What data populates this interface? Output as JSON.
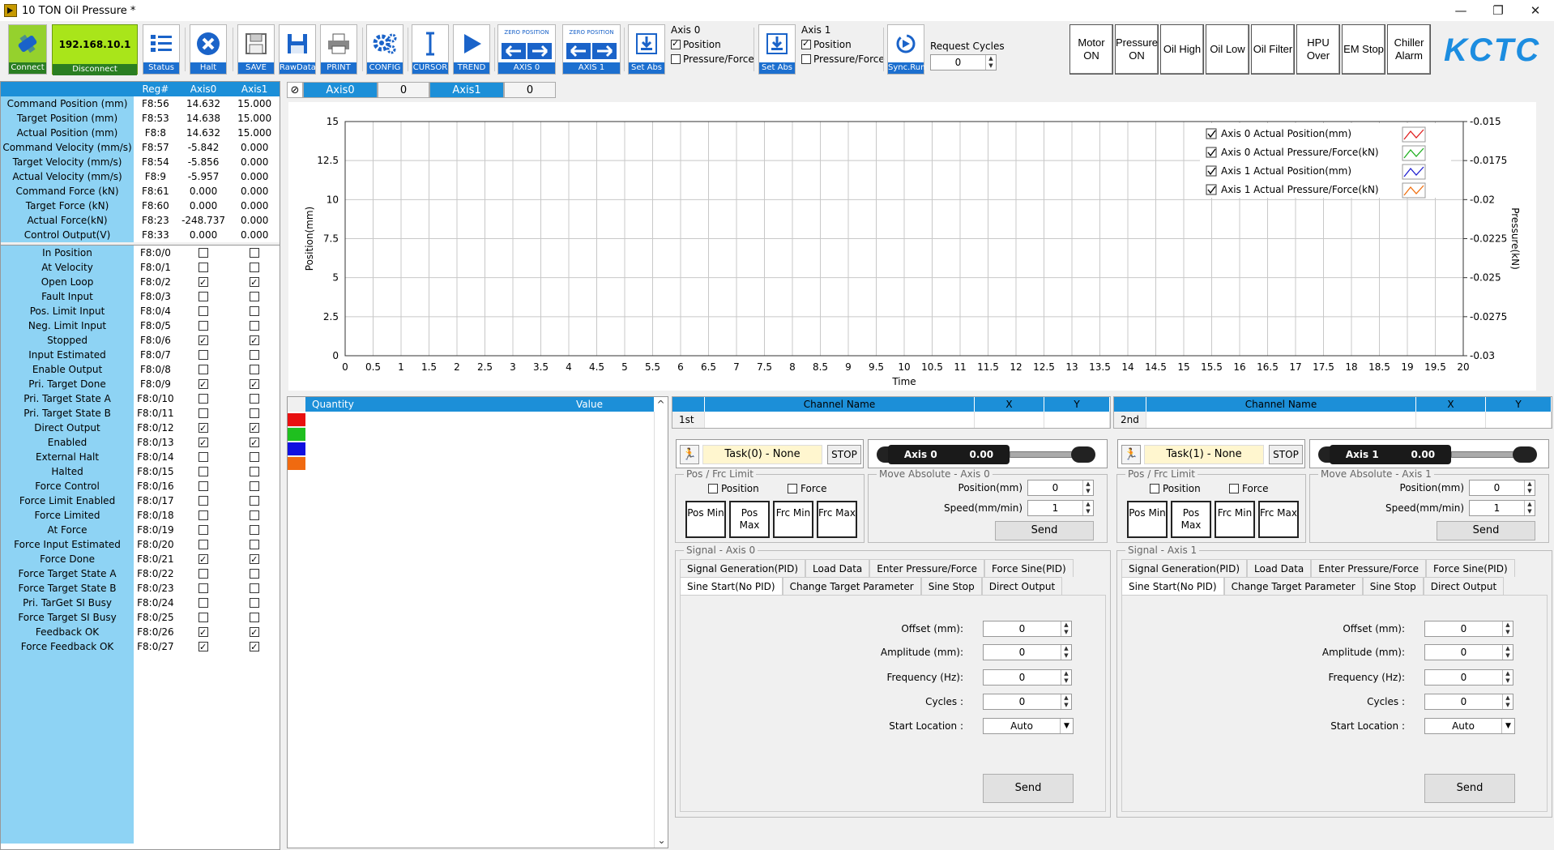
{
  "window": {
    "title": "10 TON Oil Pressure *",
    "minimize": "—",
    "restore": "❐",
    "close": "✕"
  },
  "toolbar": {
    "connect": "Connect",
    "ip": "192.168.10.1",
    "disconnect": "Disconnect",
    "status": "Status",
    "halt": "Halt",
    "save": "SAVE",
    "rawdata": "RawData",
    "print": "PRINT",
    "config": "CONFIG",
    "cursor": "CURSOR",
    "trend": "TREND",
    "zero_position": "ZERO POSITION",
    "axis0_btn": "AXIS 0",
    "axis1_btn": "AXIS 1",
    "set_abs": "Set Abs",
    "sync_run": "Sync.Run",
    "axis0": {
      "title": "Axis 0",
      "position": "Position",
      "pressure_force": "Pressure/Force",
      "position_checked": true,
      "pf_checked": false
    },
    "axis1": {
      "title": "Axis 1",
      "position": "Position",
      "pressure_force": "Pressure/Force",
      "position_checked": true,
      "pf_checked": false
    },
    "request_cycles_label": "Request Cycles",
    "request_cycles_value": "0"
  },
  "status_buttons": [
    "Motor ON",
    "Pressure ON",
    "Oil High",
    "Oil Low",
    "Oil Filter",
    "HPU Over",
    "EM Stop",
    "Chiller Alarm"
  ],
  "logo": "KCTC",
  "grid": {
    "headers": {
      "reg": "Reg#",
      "axis0": "Axis0",
      "axis1": "Axis1"
    },
    "values": [
      {
        "name": "Command Position (mm)",
        "reg": "F8:56",
        "a0": "14.632",
        "a1": "15.000"
      },
      {
        "name": "Target Position (mm)",
        "reg": "F8:53",
        "a0": "14.638",
        "a1": "15.000"
      },
      {
        "name": "Actual Position (mm)",
        "reg": "F8:8",
        "a0": "14.632",
        "a1": "15.000"
      },
      {
        "name": "Command Velocity (mm/s)",
        "reg": "F8:57",
        "a0": "-5.842",
        "a1": "0.000"
      },
      {
        "name": "Target Velocity (mm/s)",
        "reg": "F8:54",
        "a0": "-5.856",
        "a1": "0.000"
      },
      {
        "name": "Actual Velocity (mm/s)",
        "reg": "F8:9",
        "a0": "-5.957",
        "a1": "0.000"
      },
      {
        "name": "Command Force (kN)",
        "reg": "F8:61",
        "a0": "0.000",
        "a1": "0.000"
      },
      {
        "name": "Target Force (kN)",
        "reg": "F8:60",
        "a0": "0.000",
        "a1": "0.000"
      },
      {
        "name": "Actual Force(kN)",
        "reg": "F8:23",
        "a0": "-248.737",
        "a1": "0.000"
      },
      {
        "name": "Control Output(V)",
        "reg": "F8:33",
        "a0": "0.000",
        "a1": "0.000"
      }
    ],
    "flags": [
      {
        "name": "In Position",
        "reg": "F8:0/0",
        "a0": false,
        "a1": false
      },
      {
        "name": "At Velocity",
        "reg": "F8:0/1",
        "a0": false,
        "a1": false
      },
      {
        "name": "Open Loop",
        "reg": "F8:0/2",
        "a0": true,
        "a1": true
      },
      {
        "name": "Fault Input",
        "reg": "F8:0/3",
        "a0": false,
        "a1": false
      },
      {
        "name": "Pos. Limit Input",
        "reg": "F8:0/4",
        "a0": false,
        "a1": false
      },
      {
        "name": "Neg. Limit Input",
        "reg": "F8:0/5",
        "a0": false,
        "a1": false
      },
      {
        "name": "Stopped",
        "reg": "F8:0/6",
        "a0": true,
        "a1": true
      },
      {
        "name": "Input Estimated",
        "reg": "F8:0/7",
        "a0": false,
        "a1": false
      },
      {
        "name": "Enable Output",
        "reg": "F8:0/8",
        "a0": false,
        "a1": false
      },
      {
        "name": "Pri. Target Done",
        "reg": "F8:0/9",
        "a0": true,
        "a1": true
      },
      {
        "name": "Pri. Target State A",
        "reg": "F8:0/10",
        "a0": false,
        "a1": false
      },
      {
        "name": "Pri. Target State B",
        "reg": "F8:0/11",
        "a0": false,
        "a1": false
      },
      {
        "name": "Direct Output",
        "reg": "F8:0/12",
        "a0": true,
        "a1": true
      },
      {
        "name": "Enabled",
        "reg": "F8:0/13",
        "a0": true,
        "a1": true
      },
      {
        "name": "External Halt",
        "reg": "F8:0/14",
        "a0": false,
        "a1": false
      },
      {
        "name": "Halted",
        "reg": "F8:0/15",
        "a0": false,
        "a1": false
      },
      {
        "name": "Force Control",
        "reg": "F8:0/16",
        "a0": false,
        "a1": false
      },
      {
        "name": "Force Limit Enabled",
        "reg": "F8:0/17",
        "a0": false,
        "a1": false
      },
      {
        "name": "Force Limited",
        "reg": "F8:0/18",
        "a0": false,
        "a1": false
      },
      {
        "name": "At Force",
        "reg": "F8:0/19",
        "a0": false,
        "a1": false
      },
      {
        "name": "Force Input Estimated",
        "reg": "F8:0/20",
        "a0": false,
        "a1": false
      },
      {
        "name": "Force Done",
        "reg": "F8:0/21",
        "a0": true,
        "a1": true
      },
      {
        "name": "Force Target State A",
        "reg": "F8:0/22",
        "a0": false,
        "a1": false
      },
      {
        "name": "Force Target State B",
        "reg": "F8:0/23",
        "a0": false,
        "a1": false
      },
      {
        "name": "Pri. TarGet SI Busy",
        "reg": "F8:0/24",
        "a0": false,
        "a1": false
      },
      {
        "name": "Force Target SI Busy",
        "reg": "F8:0/25",
        "a0": false,
        "a1": false
      },
      {
        "name": "Feedback OK",
        "reg": "F8:0/26",
        "a0": true,
        "a1": true
      },
      {
        "name": "Force Feedback OK",
        "reg": "F8:0/27",
        "a0": true,
        "a1": true
      }
    ]
  },
  "axis_tabs": [
    {
      "label": "Axis0",
      "value": "0"
    },
    {
      "label": "Axis1",
      "value": "0"
    }
  ],
  "chart_data": {
    "type": "line",
    "xlabel": "Time",
    "ylabel": "Position(mm)",
    "y2label": "Pressure(kN)",
    "xlim": [
      0,
      20
    ],
    "ylim": [
      0,
      15
    ],
    "y2lim": [
      -0.03,
      -0.015
    ],
    "xticks": [
      "0",
      "0.5",
      "1",
      "1.5",
      "2",
      "2.5",
      "3",
      "3.5",
      "4",
      "4.5",
      "5",
      "5.5",
      "6",
      "6.5",
      "7",
      "7.5",
      "8",
      "8.5",
      "9",
      "9.5",
      "10",
      "10.5",
      "11",
      "11.5",
      "12",
      "12.5",
      "13",
      "13.5",
      "14",
      "14.5",
      "15",
      "15.5",
      "16",
      "16.5",
      "17",
      "17.5",
      "18",
      "18.5",
      "19",
      "19.5",
      "20"
    ],
    "yticks": [
      "0",
      "2.5",
      "5",
      "7.5",
      "10",
      "12.5",
      "15"
    ],
    "y2ticks": [
      "-0.03",
      "-0.0275",
      "-0.025",
      "-0.0225",
      "-0.02",
      "-0.0175",
      "-0.015"
    ],
    "grid": true,
    "legend_position": "top-right",
    "series": [
      {
        "name": "Axis 0 Actual Position(mm)",
        "color": "#e02020",
        "values": []
      },
      {
        "name": "Axis 0 Actual Pressure/Force(kN)",
        "color": "#20b020",
        "values": []
      },
      {
        "name": "Axis 1 Actual Position(mm)",
        "color": "#2020d0",
        "values": []
      },
      {
        "name": "Axis 1 Actual Pressure/Force(kN)",
        "color": "#f07010",
        "values": []
      }
    ]
  },
  "quantity": {
    "col_quantity": "Quantity",
    "col_value": "Value",
    "swatches": [
      "#e81010",
      "#1fbf1f",
      "#1010e0",
      "#f06a10"
    ]
  },
  "channels": [
    {
      "head": {
        "name": "Channel Name",
        "x": "X",
        "y": "Y"
      },
      "row": "1st"
    },
    {
      "head": {
        "name": "Channel Name",
        "x": "X",
        "y": "Y"
      },
      "row": "2nd"
    }
  ],
  "axes": [
    {
      "task": "Task(0) - None",
      "stop": "STOP",
      "cyl_label": "Axis 0",
      "cyl_value": "0.00",
      "limit_title": "Pos / Frc Limit",
      "limit_position": "Position",
      "limit_force": "Force",
      "lim_btns": [
        "Pos Min",
        "Pos Max",
        "Frc Min",
        "Frc Max"
      ],
      "move_title": "Move Absolute - Axis 0",
      "pos_label": "Position(mm)",
      "pos_value": "0",
      "speed_label": "Speed(mm/min)",
      "speed_value": "1",
      "send": "Send",
      "signal_title": "Signal - Axis 0",
      "tabs_row1": [
        "Signal Generation(PID)",
        "Load Data",
        "Enter Pressure/Force",
        "Force Sine(PID)"
      ],
      "tabs_row2": [
        "Sine Start(No PID)",
        "Change Target Parameter",
        "Sine Stop",
        "Direct Output"
      ],
      "fields": [
        {
          "label": "Offset (mm):",
          "value": "0"
        },
        {
          "label": "Amplitude (mm):",
          "value": "0"
        },
        {
          "label": "Frequency (Hz):",
          "value": "0"
        },
        {
          "label": "Cycles :",
          "value": "0"
        }
      ],
      "start_label": "Start Location :",
      "start_value": "Auto",
      "signal_send": "Send"
    },
    {
      "task": "Task(1) - None",
      "stop": "STOP",
      "cyl_label": "Axis 1",
      "cyl_value": "0.00",
      "limit_title": "Pos / Frc Limit",
      "limit_position": "Position",
      "limit_force": "Force",
      "lim_btns": [
        "Pos Min",
        "Pos Max",
        "Frc Min",
        "Frc Max"
      ],
      "move_title": "Move Absolute - Axis 1",
      "pos_label": "Position(mm)",
      "pos_value": "0",
      "speed_label": "Speed(mm/min)",
      "speed_value": "1",
      "send": "Send",
      "signal_title": "Signal - Axis 1",
      "tabs_row1": [
        "Signal Generation(PID)",
        "Load Data",
        "Enter Pressure/Force",
        "Force Sine(PID)"
      ],
      "tabs_row2": [
        "Sine Start(No PID)",
        "Change Target Parameter",
        "Sine Stop",
        "Direct Output"
      ],
      "fields": [
        {
          "label": "Offset (mm):",
          "value": "0"
        },
        {
          "label": "Amplitude (mm):",
          "value": "0"
        },
        {
          "label": "Frequency (Hz):",
          "value": "0"
        },
        {
          "label": "Cycles :",
          "value": "0"
        }
      ],
      "start_label": "Start Location :",
      "start_value": "Auto",
      "signal_send": "Send"
    }
  ]
}
